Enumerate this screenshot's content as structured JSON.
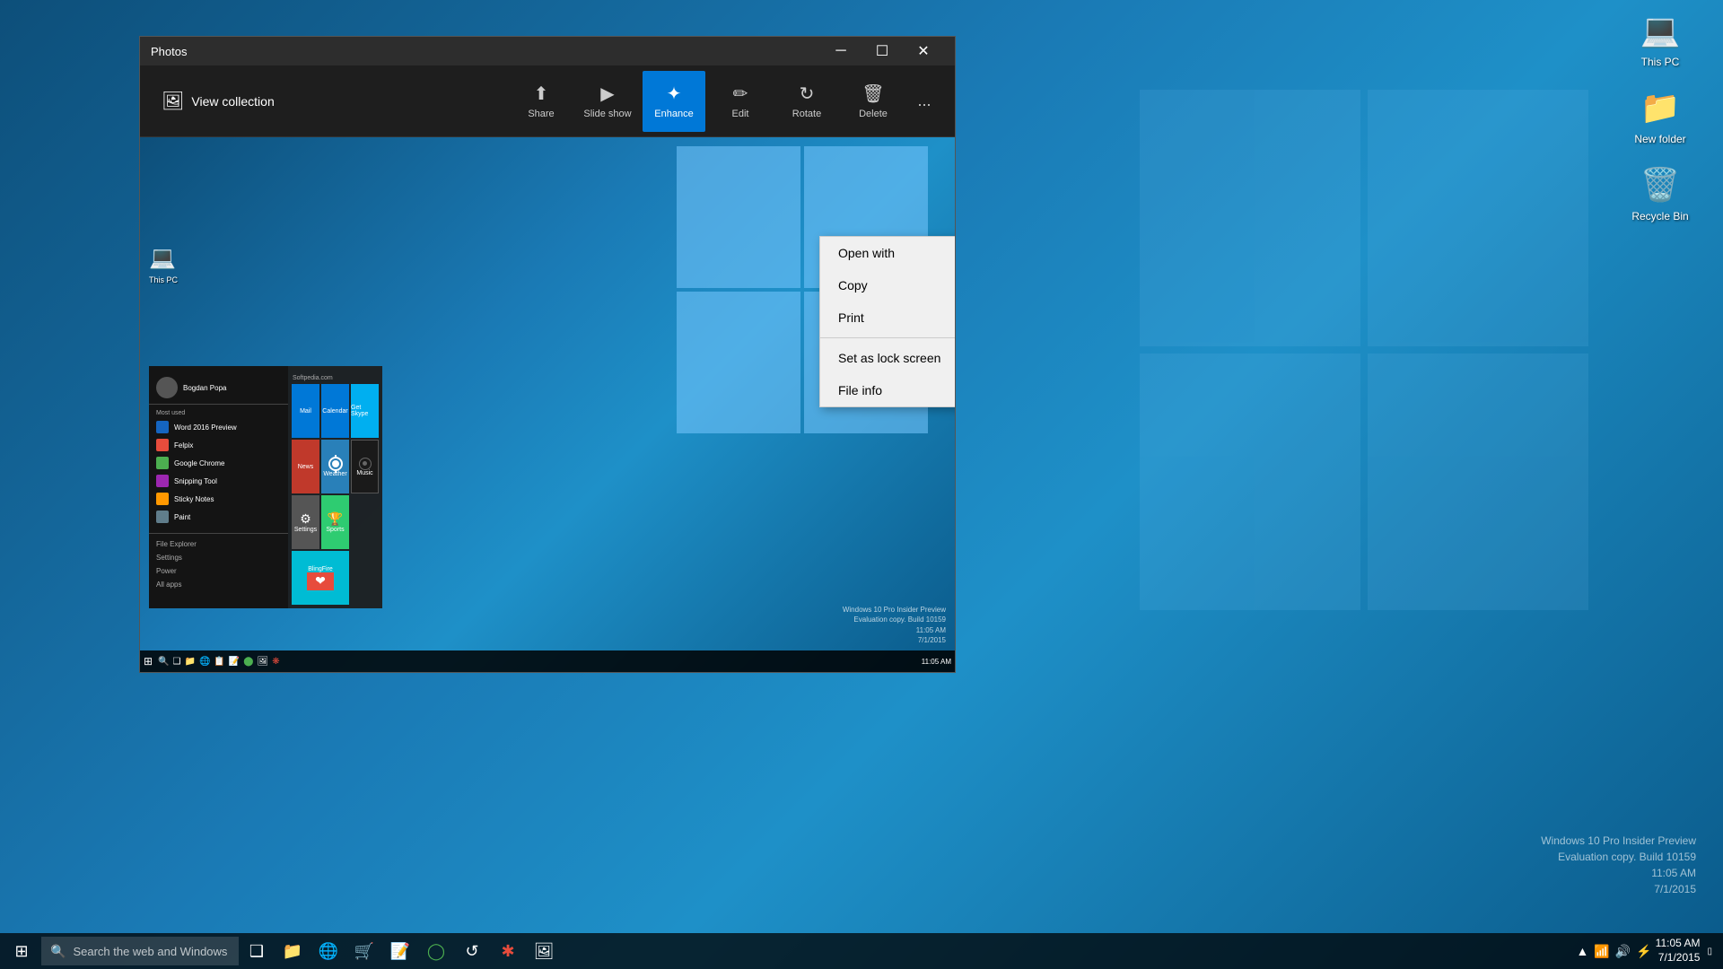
{
  "desktop": {
    "background_desc": "Windows 10 blue gradient with Windows logo"
  },
  "desktop_icons": [
    {
      "id": "this-pc",
      "label": "This PC",
      "icon": "💻"
    },
    {
      "id": "new-folder",
      "label": "New folder",
      "icon": "📁"
    },
    {
      "id": "recycle-bin",
      "label": "Recycle Bin",
      "icon": "🗑️"
    }
  ],
  "photos_window": {
    "title": "Photos",
    "toolbar": {
      "view_collection": "View collection",
      "share": "Share",
      "slide_show": "Slide show",
      "enhance": "Enhance",
      "edit": "Edit",
      "rotate": "Rotate",
      "delete": "Delete",
      "more": "..."
    },
    "context_menu": {
      "items": [
        {
          "id": "open-with",
          "label": "Open with"
        },
        {
          "id": "copy",
          "label": "Copy"
        },
        {
          "id": "print",
          "label": "Print"
        },
        {
          "divider": true
        },
        {
          "id": "set-lock-screen",
          "label": "Set as lock screen"
        },
        {
          "id": "file-info",
          "label": "File info"
        }
      ]
    }
  },
  "inner_start_menu": {
    "username": "Bogdan Popa",
    "site": "Softpedia.com",
    "most_used_label": "Most used",
    "apps": [
      {
        "label": "Word 2016 Preview"
      },
      {
        "label": "Felpix"
      },
      {
        "label": "Google Chrome"
      },
      {
        "label": "Snipping Tool"
      },
      {
        "label": "Sticky Notes"
      },
      {
        "label": "Paint"
      }
    ],
    "tiles": [
      {
        "label": "Mail",
        "class": "tile-mail"
      },
      {
        "label": "Calendar",
        "class": "tile-cal"
      },
      {
        "label": "Get Skype",
        "class": "tile-skype"
      },
      {
        "label": "News",
        "class": "tile-news"
      },
      {
        "label": "Weather",
        "class": "tile-weather"
      },
      {
        "label": "Music",
        "class": "tile-music"
      },
      {
        "label": "Settings",
        "class": "tile-settings"
      },
      {
        "label": "Sports",
        "class": "tile-sports"
      },
      {
        "label": "BlingFire",
        "class": ""
      },
      {
        "label": "",
        "class": "tile-health"
      }
    ],
    "bottom_links": [
      {
        "label": "File Explorer"
      },
      {
        "label": "Settings"
      },
      {
        "label": "Power"
      },
      {
        "label": "All apps"
      }
    ]
  },
  "watermark": {
    "line1": "Windows 10 Pro Insider Preview",
    "line2": "Evaluation copy. Build 10159",
    "line3": "11:05 AM",
    "line4": "7/1/2015"
  },
  "taskbar": {
    "search_placeholder": "Search the web and Windows",
    "clock_time": "11:05 AM",
    "clock_date": "7/1/2015",
    "icons": [
      "⊞",
      "🔍",
      "❑",
      "📁",
      "🌐",
      "✉",
      "📋",
      "🎵",
      "🔴",
      "🖼"
    ]
  }
}
